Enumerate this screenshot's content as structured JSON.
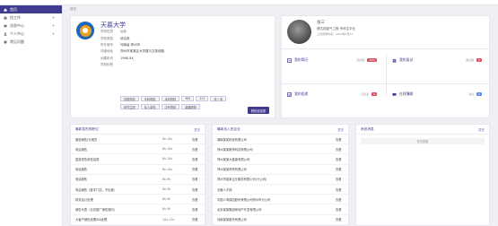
{
  "sidebar": {
    "items": [
      {
        "label": "首页",
        "active": true,
        "icon": "home-icon",
        "arrow": ""
      },
      {
        "label": "找工作",
        "active": false,
        "icon": "briefcase-icon",
        "arrow": "+"
      },
      {
        "label": "消息中心",
        "active": false,
        "icon": "message-icon",
        "arrow": "+"
      },
      {
        "label": "个人中心",
        "active": false,
        "icon": "user-icon",
        "arrow": "+"
      },
      {
        "label": "常见问题",
        "active": false,
        "icon": "question-icon",
        "arrow": ""
      }
    ]
  },
  "breadcrumb": "首页",
  "school": {
    "name": "天慕大学",
    "rows": [
      {
        "k": "学校性质",
        "v": "公办"
      },
      {
        "k": "学校类型",
        "v": "综合类"
      },
      {
        "k": "所在城市",
        "v": "河南省 郑州市"
      },
      {
        "k": "详细地址",
        "v": "郑州市某某区大学路与文苑西路"
      },
      {
        "k": "创建年份",
        "v": "1966-XX"
      },
      {
        "k": "学校标签",
        "v": ""
      }
    ],
    "tags_row1": [
      "首属院校",
      "专科院校",
      "本科院校",
      "985",
      "211",
      "双一流"
    ],
    "tags_row2": [
      "研究生院",
      "民人单校",
      "中专院校",
      "新疆院校"
    ],
    "detail_button": "院校信息表"
  },
  "profile": {
    "name": "张三",
    "line2": "博达技能气工程 专科生毕业",
    "line3": "上次登录时间：2023年4月27",
    "stats": [
      {
        "label": "我的简历",
        "progress": "完成度",
        "badge": "34%",
        "icon": "resume-icon",
        "badge_color": "#e05060"
      },
      {
        "label": "我的面试",
        "progress": "面试数",
        "badge": "0",
        "icon": "interview-icon",
        "badge_color": "#e05060"
      },
      {
        "label": "我的投递",
        "progress": "已投递",
        "badge": "0",
        "icon": "send-icon",
        "badge_color": "#e05060"
      },
      {
        "label": "在线簿聊",
        "progress": "消息",
        "badge": "0",
        "icon": "chat-icon",
        "badge_color": "#5b8def"
      }
    ]
  },
  "jobs": {
    "title": "最新发布的职位",
    "more": "更多",
    "rows": [
      {
        "name": "渠道销售/分销员",
        "salary": "6k-10k",
        "action": "查看"
      },
      {
        "name": "电话销售",
        "salary": "6k-10k",
        "action": "查看"
      },
      {
        "name": "直营零售销售结算",
        "salary": "6k-10k",
        "action": "查看"
      },
      {
        "name": "电话销售",
        "salary": "6k-10k",
        "action": "查看"
      },
      {
        "name": "电话销售",
        "salary": "6k-9k",
        "action": "查看"
      },
      {
        "name": "电话销售（数字门店，不出差）",
        "salary": "6k-9k",
        "action": "查看"
      },
      {
        "name": "财务会计处理",
        "salary": "6k-9k",
        "action": "查看"
      },
      {
        "name": "销售代表（业务推广销售顾问）",
        "salary": "6k-9k",
        "action": "查看"
      },
      {
        "name": "大客户销售经理/KA经理",
        "salary": "10k-13k",
        "action": "查看"
      }
    ]
  },
  "companies": {
    "title": "最新加入的企业",
    "more": "更多",
    "rows": [
      {
        "name": "湖南某某科技有限公司",
        "action": "查看"
      },
      {
        "name": "郑州某某教育科技有限公司",
        "action": "查看"
      },
      {
        "name": "郑州某某大健康有限公司",
        "action": "查看"
      },
      {
        "name": "郑州某某商贸有限公司",
        "action": "查看"
      },
      {
        "name": "郑州市某某企业服务有限公司(分公司)",
        "action": "查看"
      },
      {
        "name": "天鹿人才网",
        "action": "查看"
      },
      {
        "name": "中国人寿保险股份有限公司郑州市分公司",
        "action": "查看"
      },
      {
        "name": "北京某某集团房地产开发有限公司",
        "action": "查看"
      },
      {
        "name": "河南某某股份有限公司",
        "action": "查看"
      }
    ]
  },
  "notices": {
    "title": "系统消息",
    "more": "更多",
    "empty": "暂无数据"
  },
  "colors": {
    "primary": "#3f3b8e",
    "badge_red": "#e05060",
    "badge_blue": "#5b8def"
  }
}
